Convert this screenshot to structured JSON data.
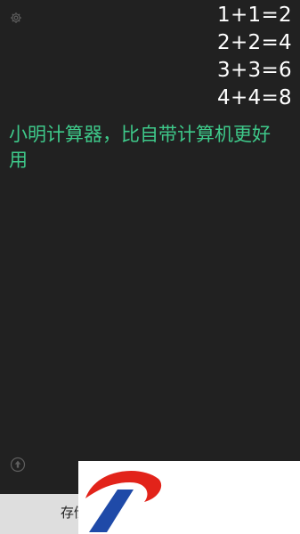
{
  "app": {
    "settings_icon": "gear-icon",
    "upload_icon": "arrow-up-circle-icon"
  },
  "history": [
    "1+1=2",
    "2+2=4",
    "3+3=6",
    "4+4=8"
  ],
  "current": {
    "text": "小明计算器，比自带计算机更好用"
  },
  "bottom_bar": {
    "label": "存储"
  },
  "colors": {
    "background": "#212121",
    "history_text": "#ffffff",
    "current_text": "#3ec98a",
    "bottom_bar": "#dedede",
    "logo_red": "#e2231a",
    "logo_blue": "#1f4aa8"
  },
  "watermark": {
    "type": "logo",
    "icon": "red-blue-swoosh-logo"
  }
}
